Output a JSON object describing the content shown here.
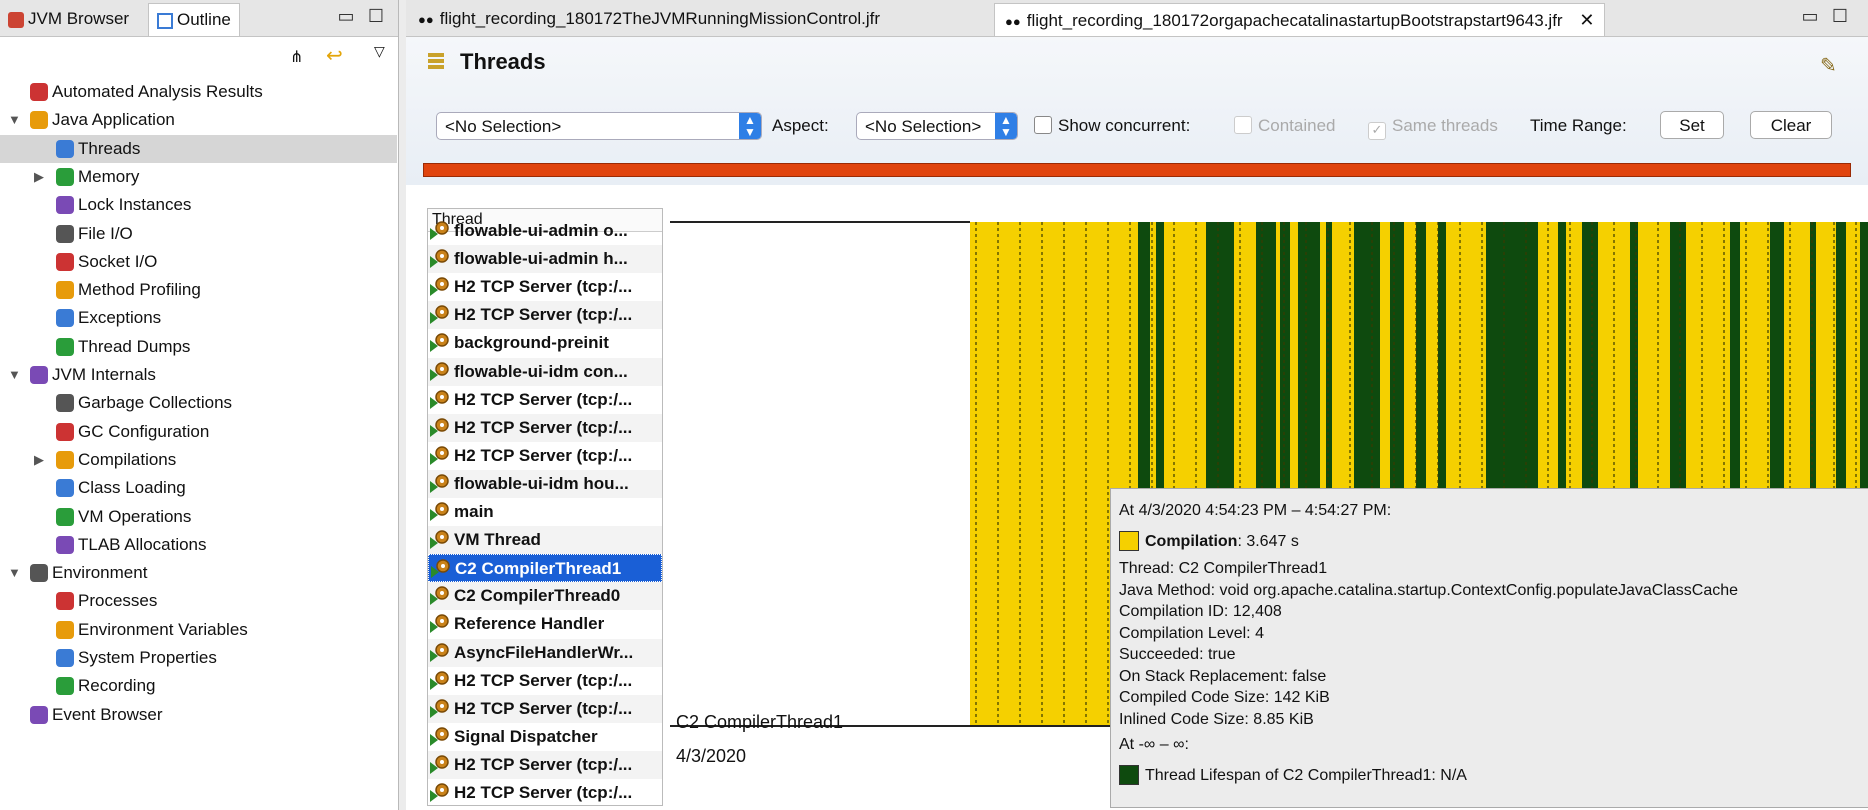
{
  "left_tabs": {
    "browser": "JVM Browser",
    "outline": "Outline"
  },
  "tree": [
    {
      "label": "Automated Analysis Results",
      "level": 0
    },
    {
      "label": "Java Application",
      "level": 0,
      "expanded": true
    },
    {
      "label": "Threads",
      "level": 1,
      "selected": true
    },
    {
      "label": "Memory",
      "level": 1,
      "collapsed": true
    },
    {
      "label": "Lock Instances",
      "level": 1
    },
    {
      "label": "File I/O",
      "level": 1
    },
    {
      "label": "Socket I/O",
      "level": 1
    },
    {
      "label": "Method Profiling",
      "level": 1
    },
    {
      "label": "Exceptions",
      "level": 1
    },
    {
      "label": "Thread Dumps",
      "level": 1
    },
    {
      "label": "JVM Internals",
      "level": 0,
      "expanded": true
    },
    {
      "label": "Garbage Collections",
      "level": 1
    },
    {
      "label": "GC Configuration",
      "level": 1
    },
    {
      "label": "Compilations",
      "level": 1,
      "collapsed": true
    },
    {
      "label": "Class Loading",
      "level": 1
    },
    {
      "label": "VM Operations",
      "level": 1
    },
    {
      "label": "TLAB Allocations",
      "level": 1
    },
    {
      "label": "Environment",
      "level": 0,
      "expanded": true
    },
    {
      "label": "Processes",
      "level": 1
    },
    {
      "label": "Environment Variables",
      "level": 1
    },
    {
      "label": "System Properties",
      "level": 1
    },
    {
      "label": "Recording",
      "level": 1
    },
    {
      "label": "Event Browser",
      "level": 0
    }
  ],
  "editor_tabs": [
    {
      "label": "flight_recording_180172TheJVMRunningMissionControl.jfr"
    },
    {
      "label": "flight_recording_180172orgapachecatalinastartupBootstrapstart9643.jfr",
      "active": true
    }
  ],
  "page": {
    "title": "Threads"
  },
  "toolbar": {
    "selection": "<No Selection>",
    "aspect_label": "Aspect:",
    "aspect_value": "<No Selection>",
    "show_concurrent": "Show concurrent:",
    "contained": "Contained",
    "same_threads": "Same threads",
    "time_range": "Time Range:",
    "set": "Set",
    "clear": "Clear"
  },
  "thread_list": {
    "header": "Thread",
    "rows": [
      "flowable-ui-admin o...",
      "flowable-ui-admin h...",
      "H2 TCP Server (tcp:/...",
      "H2 TCP Server (tcp:/...",
      "background-preinit",
      "flowable-ui-idm con...",
      "H2 TCP Server (tcp:/...",
      "H2 TCP Server (tcp:/...",
      "H2 TCP Server (tcp:/...",
      "flowable-ui-idm hou...",
      "main",
      "VM Thread",
      "C2 CompilerThread1",
      "C2 CompilerThread0",
      "Reference Handler",
      "AsyncFileHandlerWr...",
      "H2 TCP Server (tcp:/...",
      "H2 TCP Server (tcp:/...",
      "Signal Dispatcher",
      "H2 TCP Server (tcp:/...",
      "H2 TCP Server (tcp:/..."
    ],
    "selected_index": 12
  },
  "chart": {
    "thread_label": "C2 CompilerThread1",
    "date_label": "4/3/2020",
    "colors": {
      "compilation": "#f5d000",
      "lifespan": "#0e4a0e"
    }
  },
  "tooltip": {
    "range": "At 4/3/2020 4:54:23 PM – 4:54:27 PM:",
    "event_name": "Compilation",
    "event_duration": ": 3.647 s",
    "lines": [
      "Thread: C2 CompilerThread1",
      "Java Method: void org.apache.catalina.startup.ContextConfig.populateJavaClassCache",
      "Compilation ID: 12,408",
      "Compilation Level: 4",
      "Succeeded: true",
      "On Stack Replacement: false",
      "Compiled Code Size: 142 KiB",
      "Inlined Code Size: 8.85 KiB"
    ],
    "range2": "At -∞ – ∞:",
    "lifespan": "Thread Lifespan of C2 CompilerThread1: N/A"
  }
}
